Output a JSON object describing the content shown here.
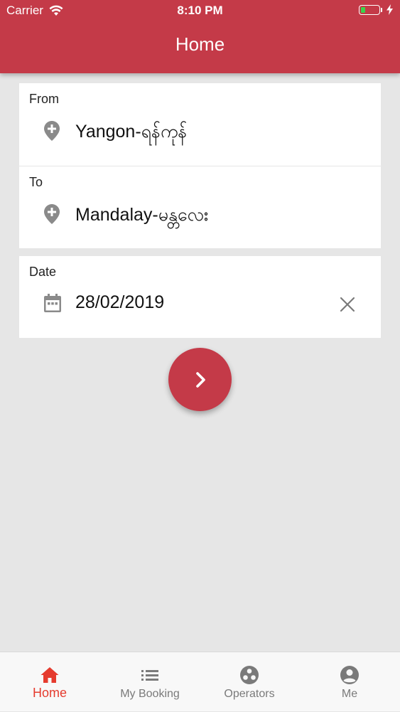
{
  "status_bar": {
    "carrier": "Carrier",
    "time": "8:10 PM"
  },
  "header": {
    "title": "Home"
  },
  "form": {
    "from": {
      "label": "From",
      "value": "Yangon-ရန်ကုန်",
      "icon": "add-location-icon"
    },
    "to": {
      "label": "To",
      "value": "Mandalay-မန္တလေး",
      "icon": "add-location-icon"
    },
    "date": {
      "label": "Date",
      "value": "28/02/2019",
      "icon": "calendar-icon",
      "clear_icon": "close-icon"
    },
    "next_icon": "chevron-right-icon"
  },
  "tabs": [
    {
      "label": "Home",
      "icon": "home-icon",
      "active": true
    },
    {
      "label": "My Booking",
      "icon": "list-icon",
      "active": false
    },
    {
      "label": "Operators",
      "icon": "operators-icon",
      "active": false
    },
    {
      "label": "Me",
      "icon": "account-icon",
      "active": false
    }
  ],
  "colors": {
    "primary": "#c43a48",
    "active_tab": "#e53b2e",
    "inactive_tab": "#7a7a7a",
    "background": "#e6e6e6",
    "battery": "#3ad24a"
  }
}
